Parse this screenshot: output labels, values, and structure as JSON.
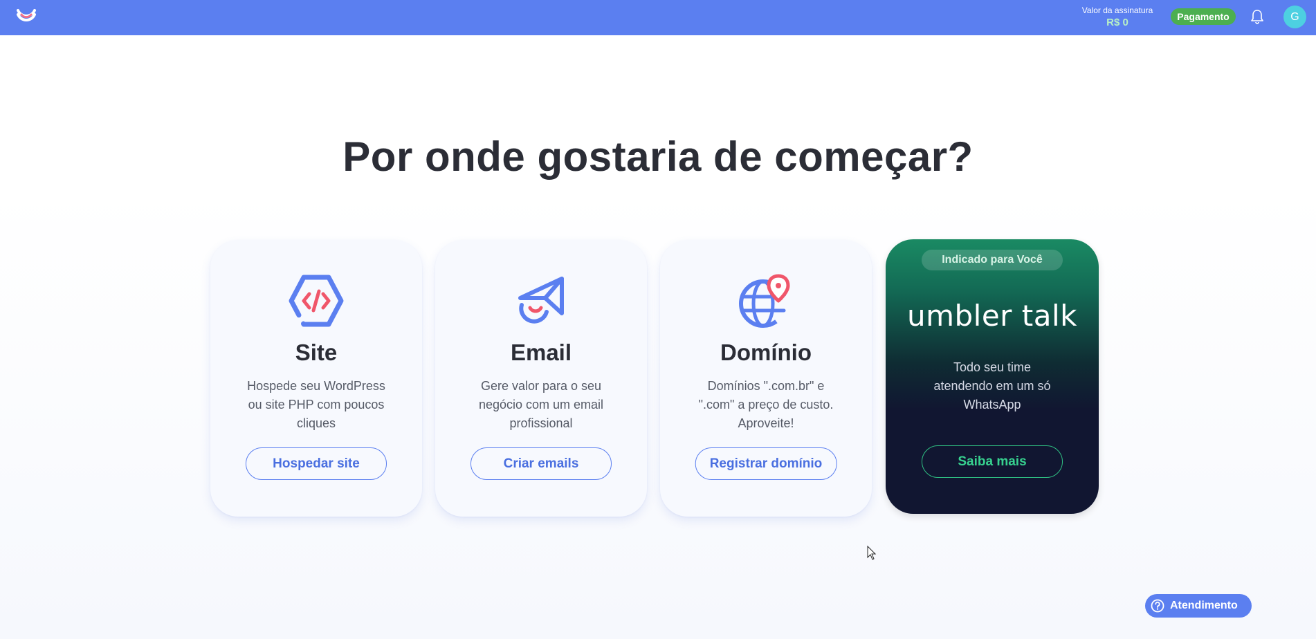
{
  "header": {
    "subscription_label": "Valor da assinatura",
    "subscription_value": "R$ 0",
    "payment_label": "Pagamento",
    "avatar_initial": "G"
  },
  "main": {
    "title": "Por onde gostaria de começar?"
  },
  "cards": [
    {
      "icon": "code-hexagon-icon",
      "title": "Site",
      "description": "Hospede seu WordPress ou site PHP com poucos cliques",
      "button_label": "Hospedar site"
    },
    {
      "icon": "paper-plane-icon",
      "title": "Email",
      "description": "Gere valor para o seu negócio com um email profissional",
      "button_label": "Criar emails"
    },
    {
      "icon": "globe-pin-icon",
      "title": "Domínio",
      "description": "Domínios \".com.br\" e \".com\" a preço de custo. Aproveite!",
      "button_label": "Registrar domínio"
    }
  ],
  "promo": {
    "badge": "Indicado para Você",
    "logo_text": "umbler talk",
    "description": "Todo seu time atendendo em um só WhatsApp",
    "button_label": "Saiba mais"
  },
  "help": {
    "label": "Atendimento"
  },
  "colors": {
    "header_bg": "#5b7ff0",
    "accent": "#4a6fe0",
    "payment_green": "#4caf50",
    "promo_green": "#37d18f",
    "icon_red": "#f0566a"
  }
}
